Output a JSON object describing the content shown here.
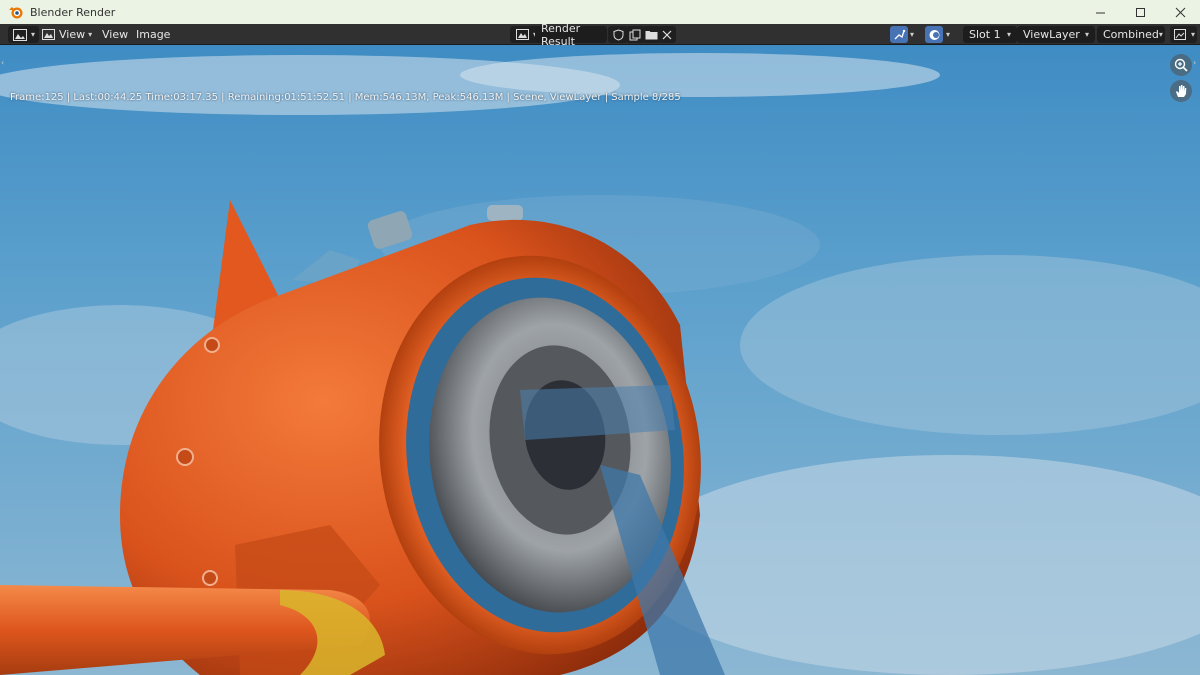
{
  "window": {
    "title": "Blender Render",
    "controls": {
      "minimize": "minimize-icon",
      "maximize": "maximize-icon",
      "close": "close-icon"
    }
  },
  "header": {
    "editor_type_icon": "image-editor-icon",
    "menus": [
      "View",
      "View",
      "Image"
    ],
    "image_name": "Render Result",
    "slot": "Slot 1",
    "view_layer": "ViewLayer",
    "pass": "Combined"
  },
  "stats": {
    "text": "Frame:125 | Last:00:44.25 Time:03:17.35 | Remaining:01:51:52.51 | Mem:546.13M, Peak:546.13M | Scene, ViewLayer | Sample 8/285"
  },
  "colors": {
    "accent": "#4772b3",
    "header_bg": "#303030",
    "sky": "#4e98c8",
    "plane": "#e0561c"
  }
}
